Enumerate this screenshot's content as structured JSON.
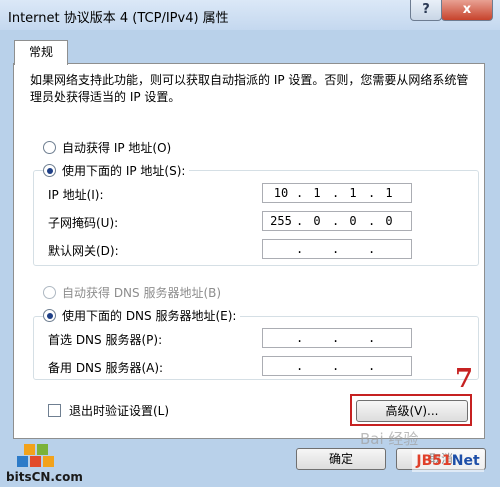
{
  "window": {
    "title": "Internet 协议版本 4 (TCP/IPv4) 属性",
    "help_label": "?",
    "close_label": "x"
  },
  "tab": {
    "label": "常规"
  },
  "description": "如果网络支持此功能，则可以获取自动指派的 IP 设置。否则，您需要从网络系统管理员处获得适当的 IP 设置。",
  "ip_section": {
    "auto_label": "自动获得 IP 地址(O)",
    "manual_label": "使用下面的 IP 地址(S):",
    "selected": "manual",
    "fields": [
      {
        "label": "IP 地址(I):",
        "segments": [
          "10",
          "1",
          "1",
          "1"
        ]
      },
      {
        "label": "子网掩码(U):",
        "segments": [
          "255",
          "0",
          "0",
          "0"
        ]
      },
      {
        "label": "默认网关(D):",
        "segments": [
          "",
          "",
          "",
          ""
        ]
      }
    ]
  },
  "dns_section": {
    "auto_label": "自动获得 DNS 服务器地址(B)",
    "manual_label": "使用下面的 DNS 服务器地址(E):",
    "selected": "manual",
    "fields": [
      {
        "label": "首选 DNS 服务器(P):",
        "segments": [
          "",
          "",
          "",
          ""
        ]
      },
      {
        "label": "备用 DNS 服务器(A):",
        "segments": [
          "",
          "",
          "",
          ""
        ]
      }
    ]
  },
  "validate_checkbox": {
    "label": "退出时验证设置(L)",
    "checked": false
  },
  "buttons": {
    "advanced": "高级(V)...",
    "ok": "确定",
    "cancel": "取消"
  },
  "annotation": {
    "step": "7",
    "color": "#c62121"
  },
  "watermarks": {
    "left": "bitsCN.com",
    "baidu": "Bai 经验",
    "jb": "JB51",
    "jb_net": "Net"
  }
}
